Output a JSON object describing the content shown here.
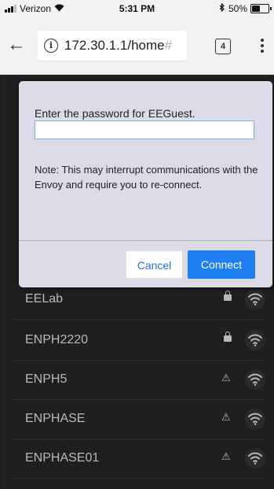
{
  "status_bar": {
    "carrier": "Verizon",
    "time": "5:31 PM",
    "battery_text": "50%",
    "battery_level": 0.5
  },
  "browser": {
    "url_main": "172.30.1.1/home",
    "url_faded": "#",
    "tab_count": "4"
  },
  "dialog": {
    "prompt": "Enter the password for EEGuest.",
    "password_value": "",
    "note": "Note: This may interrupt communications with the Envoy and require you to re-connect.",
    "cancel_label": "Cancel",
    "connect_label": "Connect",
    "connect_color": "#1e7ff0"
  },
  "networks": [
    {
      "name": "EELab",
      "status_icon": "lock-icon"
    },
    {
      "name": "ENPH2220",
      "status_icon": "lock-icon"
    },
    {
      "name": "ENPH5",
      "status_icon": "warning-icon"
    },
    {
      "name": "ENPHASE",
      "status_icon": "warning-icon"
    },
    {
      "name": "ENPHASE01",
      "status_icon": "warning-icon"
    }
  ],
  "icons": {
    "back": "back-arrow-icon",
    "info": "info-icon",
    "menu": "kebab-menu-icon",
    "wifi": "wifi-icon",
    "bluetooth": "bluetooth-icon",
    "battery": "battery-icon",
    "signal": "signal-icon"
  }
}
